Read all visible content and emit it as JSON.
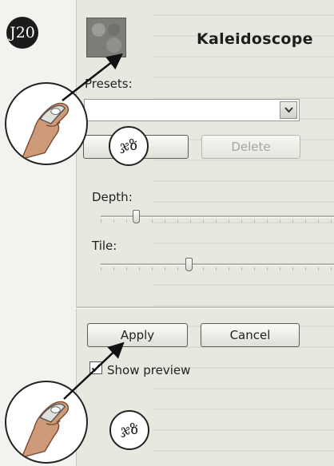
{
  "annotation": {
    "step_number": "J20",
    "step1_glyph": "ჯზ",
    "step2_glyph": "ჯზ"
  },
  "dialog": {
    "title": "Kaleidoscope",
    "presets_label": "Presets:",
    "presets_value": "",
    "save_label": "",
    "delete_label": "Delete",
    "depth_label": "Depth:",
    "depth_level": 0.2,
    "tile_label": "Tile:",
    "tile_level": 0.5,
    "apply_label": "Apply",
    "cancel_label": "Cancel",
    "show_preview_label": "Show preview",
    "show_preview_checked": true
  },
  "colors": {
    "dialog_bg": "#e9e8e0",
    "button_border": "#5c5c57"
  },
  "icons": [
    "dropdown-arrow-icon",
    "mouse-hand-icon",
    "checkmark-icon"
  ]
}
